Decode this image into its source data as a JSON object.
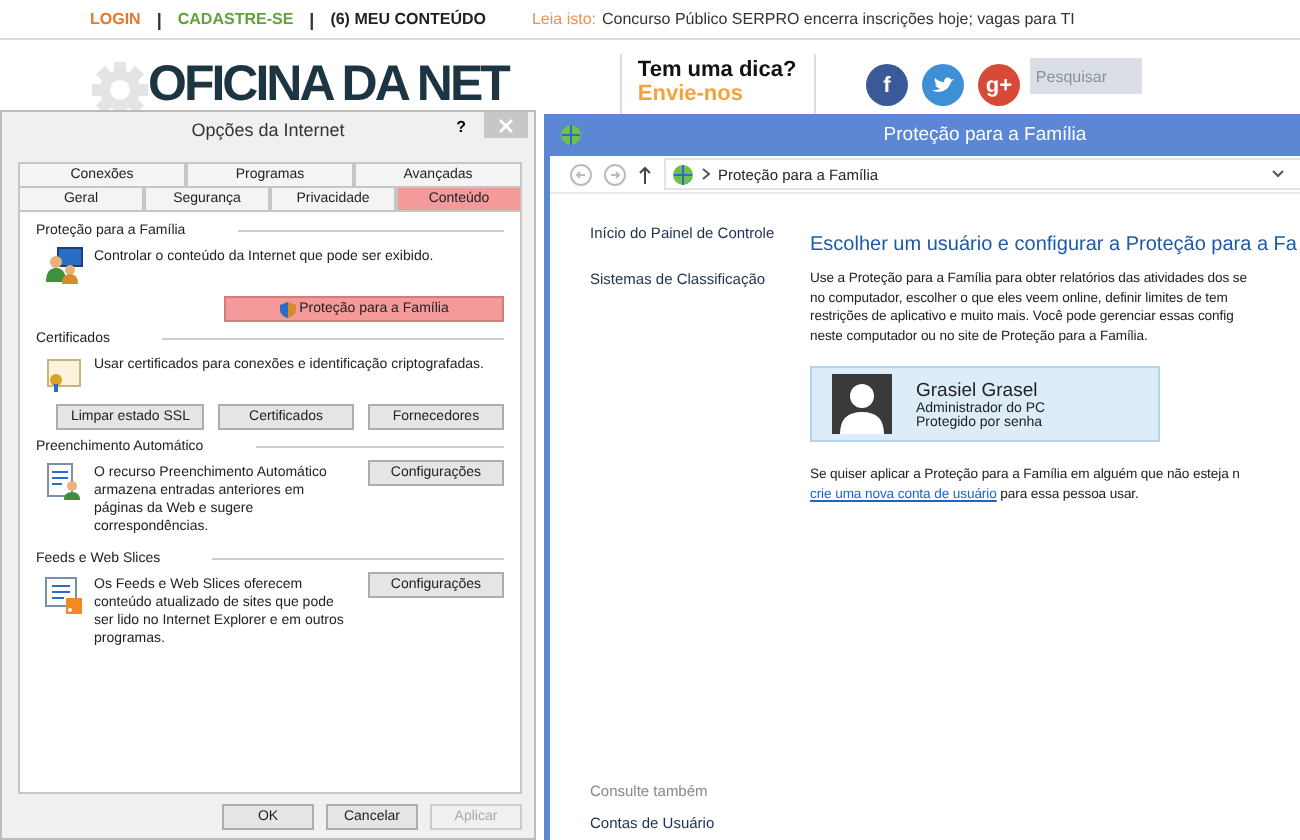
{
  "site": {
    "top_links": [
      {
        "kind": "link",
        "label": "LOGIN",
        "color": "#e8772e"
      },
      {
        "kind": "separator",
        "label": "|",
        "color": "#333333"
      },
      {
        "kind": "link",
        "label": "CADASTRE-SE",
        "color": "#5fa33a"
      },
      {
        "kind": "separator",
        "label": "|",
        "color": "#333333"
      },
      {
        "kind": "link",
        "label": "(6) MEU CONTEÚDO",
        "color": "#222222"
      }
    ],
    "notice": {
      "label": "Leia isto:",
      "text": "Concurso Público SERPRO encerra inscrições hoje; vagas para TI"
    },
    "logo": "OFICINA DA NET",
    "tip": {
      "title": "Tem uma dica?",
      "link": "Envie-nos"
    },
    "social": [
      {
        "kind": "letter",
        "glyph": "f",
        "color": "#3b5998"
      },
      {
        "kind": "bird",
        "color": "#3d8fd6"
      },
      {
        "kind": "letter",
        "glyph": "g+",
        "color": "#d64a37"
      }
    ],
    "search": {
      "placeholder": "Pesquisar"
    }
  },
  "internet_options": {
    "title": "Opções da Internet",
    "help": "?",
    "tabs_back": [
      {
        "label": "Conexões",
        "selected": false
      },
      {
        "label": "Programas",
        "selected": false
      },
      {
        "label": "Avançadas",
        "selected": false
      }
    ],
    "tabs_front": [
      {
        "label": "Geral",
        "selected": false
      },
      {
        "label": "Segurança",
        "selected": false
      },
      {
        "label": "Privacidade",
        "selected": false
      },
      {
        "label": "Conteúdo",
        "selected": true
      }
    ],
    "sections": [
      {
        "kind": "family",
        "title": "Proteção para a Família",
        "text": "Controlar o conteúdo da Internet que pode ser exibido.",
        "buttons": [
          {
            "label": "Proteção para a Família",
            "highlighted": true
          }
        ]
      },
      {
        "kind": "certificates",
        "title": "Certificados",
        "text": "Usar certificados para conexões e identificação criptografadas.",
        "buttons": [
          {
            "label": "Limpar estado SSL",
            "highlighted": false
          },
          {
            "label": "Certificados",
            "highlighted": false
          },
          {
            "label": "Fornecedores",
            "highlighted": false
          }
        ]
      },
      {
        "kind": "autocomplete",
        "title": "Preenchimento Automático",
        "text": "O recurso Preenchimento Automático armazena entradas anteriores em páginas da Web e sugere correspondências.",
        "buttons": [
          {
            "label": "Configurações",
            "highlighted": false
          }
        ]
      },
      {
        "kind": "feeds",
        "title": "Feeds e Web Slices",
        "text": "Os Feeds e Web Slices oferecem conteúdo atualizado de sites que pode ser lido no Internet Explorer e em outros programas.",
        "buttons": [
          {
            "label": "Configurações",
            "highlighted": false
          }
        ]
      }
    ],
    "footer_buttons": [
      {
        "label": "OK",
        "disabled": false
      },
      {
        "label": "Cancelar",
        "disabled": false
      },
      {
        "label": "Aplicar",
        "disabled": true
      }
    ]
  },
  "family_window": {
    "title": "Proteção para a Família",
    "breadcrumb": "Proteção para a Família",
    "sidebar_links": [
      "Início do Painel de Controle",
      "Sistemas de Classificação"
    ],
    "see_also": {
      "title": "Consulte também",
      "links": [
        "Contas de Usuário"
      ]
    },
    "heading": "Escolher um usuário e configurar a Proteção para a Fa",
    "description_lines": [
      "Use a Proteção para a Família para obter relatórios das atividades dos se",
      "no computador, escolher o que eles veem online, definir limites de tem",
      "restrições de aplicativo e muito mais. Você pode gerenciar essas config",
      "neste computador ou no site de Proteção para a Família."
    ],
    "users": [
      {
        "name": "Grasiel Grasel",
        "role": "Administrador do PC",
        "status": "Protegido por senha"
      }
    ],
    "note": "Se quiser aplicar a Proteção para a Família em alguém que não esteja n",
    "note_link": "crie uma nova conta de usuário",
    "note_after": "para essa pessoa usar."
  }
}
